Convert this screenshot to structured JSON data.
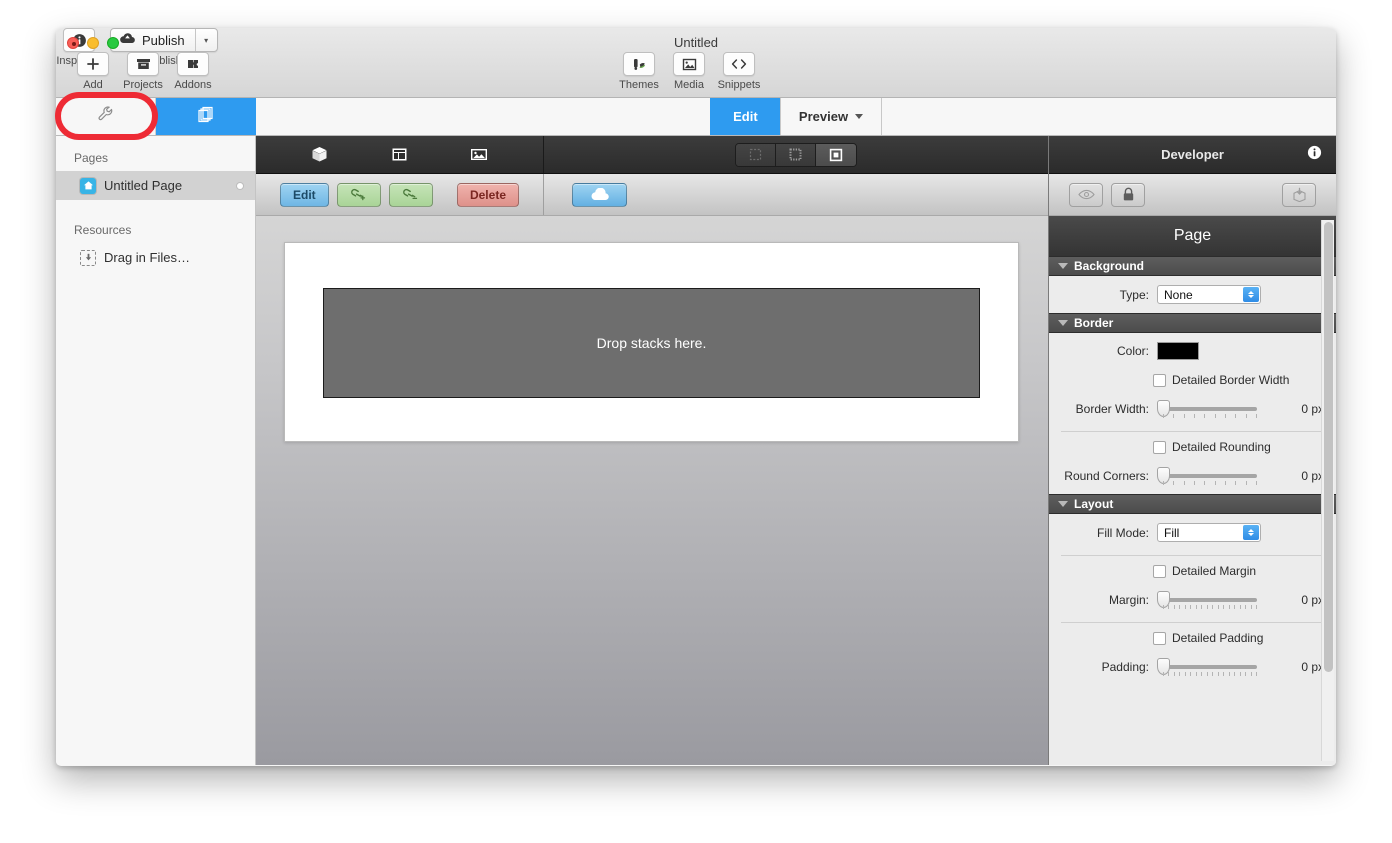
{
  "window": {
    "title": "Untitled",
    "traffic_lights": [
      "close",
      "minimize",
      "zoom"
    ]
  },
  "toolbar": {
    "left_items": [
      {
        "label": "Add",
        "icon": "plus-icon"
      },
      {
        "label": "Projects",
        "icon": "archive-box-icon"
      },
      {
        "label": "Addons",
        "icon": "addon-plug-icon"
      }
    ],
    "mid_items": [
      {
        "label": "Themes",
        "icon": "themes-paint-icon"
      },
      {
        "label": "Media",
        "icon": "media-image-icon"
      },
      {
        "label": "Snippets",
        "icon": "code-brackets-icon"
      }
    ],
    "inspector": {
      "label": "Inspector",
      "icon": "info-circle-icon"
    },
    "publish": {
      "label": "Publish",
      "caption": "Publish",
      "icon": "publish-cloud-icon",
      "arrow": "▾"
    }
  },
  "tabstrip": {
    "side_tabs": [
      {
        "name": "tools",
        "icon": "wrench-icon",
        "active": false
      },
      {
        "name": "pages",
        "icon": "stacked-pages-icon",
        "active": true
      }
    ],
    "mode_buttons": [
      {
        "label": "Edit",
        "active": true
      },
      {
        "label": "Preview",
        "active": false,
        "has_menu": true
      }
    ]
  },
  "sidebar": {
    "sections": [
      {
        "heading": "Pages",
        "items": [
          {
            "label": "Untitled Page",
            "icon": "home-page-icon",
            "selected": true,
            "has_dot": true
          }
        ]
      },
      {
        "heading": "Resources",
        "items": [
          {
            "label": "Drag in Files…",
            "icon": "drag-in-files-icon",
            "selected": false,
            "has_dot": false
          }
        ]
      }
    ]
  },
  "dark_toolbar": {
    "left_icons": [
      {
        "name": "stack-cube-icon"
      },
      {
        "name": "layout-panel-icon"
      },
      {
        "name": "image-placeholder-icon"
      }
    ],
    "view_segments": [
      {
        "name": "desktop-view",
        "active": false
      },
      {
        "name": "tablet-view",
        "active": false
      },
      {
        "name": "mobile-view",
        "active": true
      }
    ]
  },
  "action_bar": {
    "buttons": [
      {
        "label": "Edit",
        "style": "blue",
        "name": "edit-button"
      },
      {
        "label": "",
        "style": "green",
        "name": "link-add-button",
        "icon": "link-plus-icon"
      },
      {
        "label": "",
        "style": "green",
        "name": "link-remove-button",
        "icon": "link-minus-icon"
      },
      {
        "label": "Delete",
        "style": "red",
        "name": "delete-button"
      }
    ],
    "cloud_button": {
      "name": "publish-cloud-button",
      "icon": "cloud-icon"
    }
  },
  "canvas": {
    "dropzone_text": "Drop stacks here."
  },
  "developer_panel": {
    "title": "Developer",
    "info_icon": "info-circle-icon",
    "buttons": [
      {
        "name": "preview-eye-button",
        "icon": "eye-icon",
        "disabled": true
      },
      {
        "name": "lock-button",
        "icon": "lock-icon",
        "disabled": false
      },
      {
        "name": "export-box-button",
        "icon": "box-download-icon",
        "disabled": true
      }
    ]
  },
  "inspector": {
    "title": "Page",
    "sections": [
      {
        "name": "Background",
        "rows": [
          {
            "kind": "select",
            "label": "Type:",
            "value": "None"
          }
        ]
      },
      {
        "name": "Border",
        "rows": [
          {
            "kind": "color",
            "label": "Color:",
            "value": "#000000"
          },
          {
            "kind": "checkbox",
            "label": "Detailed Border Width",
            "checked": false
          },
          {
            "kind": "slider",
            "label": "Border Width:",
            "value": "0 px"
          },
          {
            "kind": "divider"
          },
          {
            "kind": "checkbox",
            "label": "Detailed Rounding",
            "checked": false
          },
          {
            "kind": "slider",
            "label": "Round Corners:",
            "value": "0 px"
          }
        ]
      },
      {
        "name": "Layout",
        "rows": [
          {
            "kind": "select",
            "label": "Fill Mode:",
            "value": "Fill"
          },
          {
            "kind": "divider"
          },
          {
            "kind": "checkbox",
            "label": "Detailed Margin",
            "checked": false
          },
          {
            "kind": "slider",
            "label": "Margin:",
            "value": "0 px"
          },
          {
            "kind": "divider"
          },
          {
            "kind": "checkbox",
            "label": "Detailed Padding",
            "checked": false
          },
          {
            "kind": "slider",
            "label": "Padding:",
            "value": "0 px"
          }
        ]
      }
    ]
  },
  "annotation": {
    "shape": "red-ellipse-highlight",
    "color": "#ee2b35",
    "targets": "tools-tab"
  }
}
